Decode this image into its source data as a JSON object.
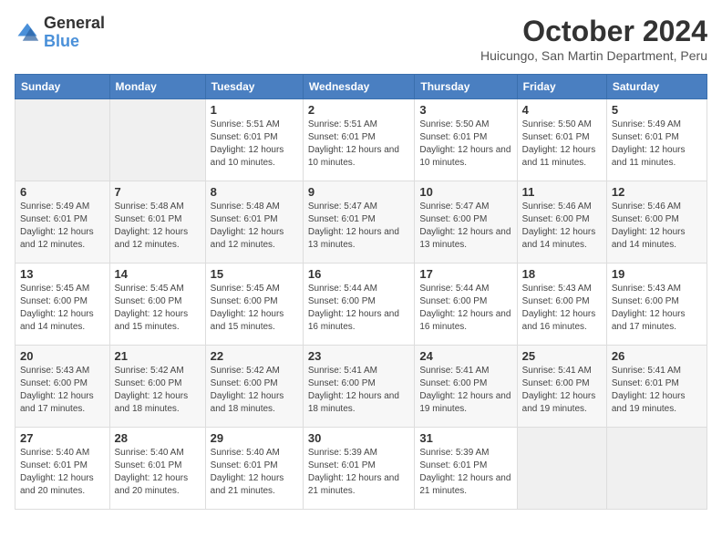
{
  "logo": {
    "line1": "General",
    "line2": "Blue"
  },
  "title": "October 2024",
  "subtitle": "Huicungo, San Martin Department, Peru",
  "days_of_week": [
    "Sunday",
    "Monday",
    "Tuesday",
    "Wednesday",
    "Thursday",
    "Friday",
    "Saturday"
  ],
  "weeks": [
    [
      {
        "day": "",
        "info": ""
      },
      {
        "day": "",
        "info": ""
      },
      {
        "day": "1",
        "info": "Sunrise: 5:51 AM\nSunset: 6:01 PM\nDaylight: 12 hours\nand 10 minutes."
      },
      {
        "day": "2",
        "info": "Sunrise: 5:51 AM\nSunset: 6:01 PM\nDaylight: 12 hours\nand 10 minutes."
      },
      {
        "day": "3",
        "info": "Sunrise: 5:50 AM\nSunset: 6:01 PM\nDaylight: 12 hours\nand 10 minutes."
      },
      {
        "day": "4",
        "info": "Sunrise: 5:50 AM\nSunset: 6:01 PM\nDaylight: 12 hours\nand 11 minutes."
      },
      {
        "day": "5",
        "info": "Sunrise: 5:49 AM\nSunset: 6:01 PM\nDaylight: 12 hours\nand 11 minutes."
      }
    ],
    [
      {
        "day": "6",
        "info": "Sunrise: 5:49 AM\nSunset: 6:01 PM\nDaylight: 12 hours\nand 12 minutes."
      },
      {
        "day": "7",
        "info": "Sunrise: 5:48 AM\nSunset: 6:01 PM\nDaylight: 12 hours\nand 12 minutes."
      },
      {
        "day": "8",
        "info": "Sunrise: 5:48 AM\nSunset: 6:01 PM\nDaylight: 12 hours\nand 12 minutes."
      },
      {
        "day": "9",
        "info": "Sunrise: 5:47 AM\nSunset: 6:01 PM\nDaylight: 12 hours\nand 13 minutes."
      },
      {
        "day": "10",
        "info": "Sunrise: 5:47 AM\nSunset: 6:00 PM\nDaylight: 12 hours\nand 13 minutes."
      },
      {
        "day": "11",
        "info": "Sunrise: 5:46 AM\nSunset: 6:00 PM\nDaylight: 12 hours\nand 14 minutes."
      },
      {
        "day": "12",
        "info": "Sunrise: 5:46 AM\nSunset: 6:00 PM\nDaylight: 12 hours\nand 14 minutes."
      }
    ],
    [
      {
        "day": "13",
        "info": "Sunrise: 5:45 AM\nSunset: 6:00 PM\nDaylight: 12 hours\nand 14 minutes."
      },
      {
        "day": "14",
        "info": "Sunrise: 5:45 AM\nSunset: 6:00 PM\nDaylight: 12 hours\nand 15 minutes."
      },
      {
        "day": "15",
        "info": "Sunrise: 5:45 AM\nSunset: 6:00 PM\nDaylight: 12 hours\nand 15 minutes."
      },
      {
        "day": "16",
        "info": "Sunrise: 5:44 AM\nSunset: 6:00 PM\nDaylight: 12 hours\nand 16 minutes."
      },
      {
        "day": "17",
        "info": "Sunrise: 5:44 AM\nSunset: 6:00 PM\nDaylight: 12 hours\nand 16 minutes."
      },
      {
        "day": "18",
        "info": "Sunrise: 5:43 AM\nSunset: 6:00 PM\nDaylight: 12 hours\nand 16 minutes."
      },
      {
        "day": "19",
        "info": "Sunrise: 5:43 AM\nSunset: 6:00 PM\nDaylight: 12 hours\nand 17 minutes."
      }
    ],
    [
      {
        "day": "20",
        "info": "Sunrise: 5:43 AM\nSunset: 6:00 PM\nDaylight: 12 hours\nand 17 minutes."
      },
      {
        "day": "21",
        "info": "Sunrise: 5:42 AM\nSunset: 6:00 PM\nDaylight: 12 hours\nand 18 minutes."
      },
      {
        "day": "22",
        "info": "Sunrise: 5:42 AM\nSunset: 6:00 PM\nDaylight: 12 hours\nand 18 minutes."
      },
      {
        "day": "23",
        "info": "Sunrise: 5:41 AM\nSunset: 6:00 PM\nDaylight: 12 hours\nand 18 minutes."
      },
      {
        "day": "24",
        "info": "Sunrise: 5:41 AM\nSunset: 6:00 PM\nDaylight: 12 hours\nand 19 minutes."
      },
      {
        "day": "25",
        "info": "Sunrise: 5:41 AM\nSunset: 6:00 PM\nDaylight: 12 hours\nand 19 minutes."
      },
      {
        "day": "26",
        "info": "Sunrise: 5:41 AM\nSunset: 6:01 PM\nDaylight: 12 hours\nand 19 minutes."
      }
    ],
    [
      {
        "day": "27",
        "info": "Sunrise: 5:40 AM\nSunset: 6:01 PM\nDaylight: 12 hours\nand 20 minutes."
      },
      {
        "day": "28",
        "info": "Sunrise: 5:40 AM\nSunset: 6:01 PM\nDaylight: 12 hours\nand 20 minutes."
      },
      {
        "day": "29",
        "info": "Sunrise: 5:40 AM\nSunset: 6:01 PM\nDaylight: 12 hours\nand 21 minutes."
      },
      {
        "day": "30",
        "info": "Sunrise: 5:39 AM\nSunset: 6:01 PM\nDaylight: 12 hours\nand 21 minutes."
      },
      {
        "day": "31",
        "info": "Sunrise: 5:39 AM\nSunset: 6:01 PM\nDaylight: 12 hours\nand 21 minutes."
      },
      {
        "day": "",
        "info": ""
      },
      {
        "day": "",
        "info": ""
      }
    ]
  ]
}
